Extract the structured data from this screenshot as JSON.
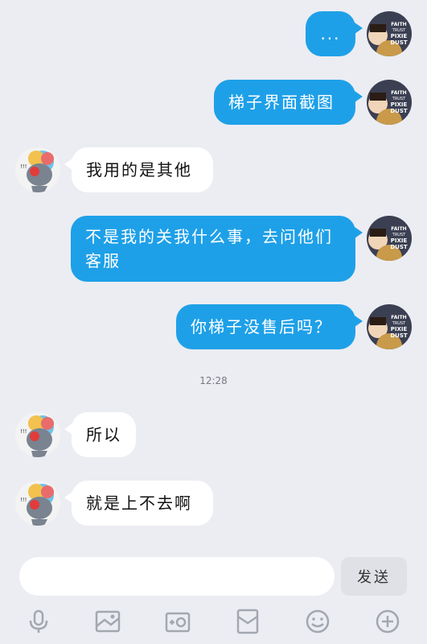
{
  "messages": [
    {
      "side": "out",
      "text": "..."
    },
    {
      "side": "out",
      "text": "梯子界面截图"
    },
    {
      "side": "in",
      "text": "我用的是其他"
    },
    {
      "side": "out",
      "text": "不是我的关我什么事，去问他们客服"
    },
    {
      "side": "out",
      "text": "你梯子没售后吗？"
    },
    {
      "side": "in",
      "text": "所以"
    },
    {
      "side": "in",
      "text": "就是上不去啊"
    }
  ],
  "timestamp": "12:28",
  "composer": {
    "input_value": "",
    "send_label": "发送"
  },
  "self_avatar_text": [
    "FAITH",
    "TRUST",
    "PIXIE",
    "DUST"
  ],
  "toolbar_icons": [
    "microphone-icon",
    "image-icon",
    "camera-icon",
    "red-packet-icon",
    "emoji-icon",
    "plus-icon"
  ],
  "colors": {
    "background": "#ebedf2",
    "outgoing_bubble": "#1ea0e8",
    "incoming_bubble": "#ffffff",
    "toolbar_icon": "#a3a7b0"
  }
}
